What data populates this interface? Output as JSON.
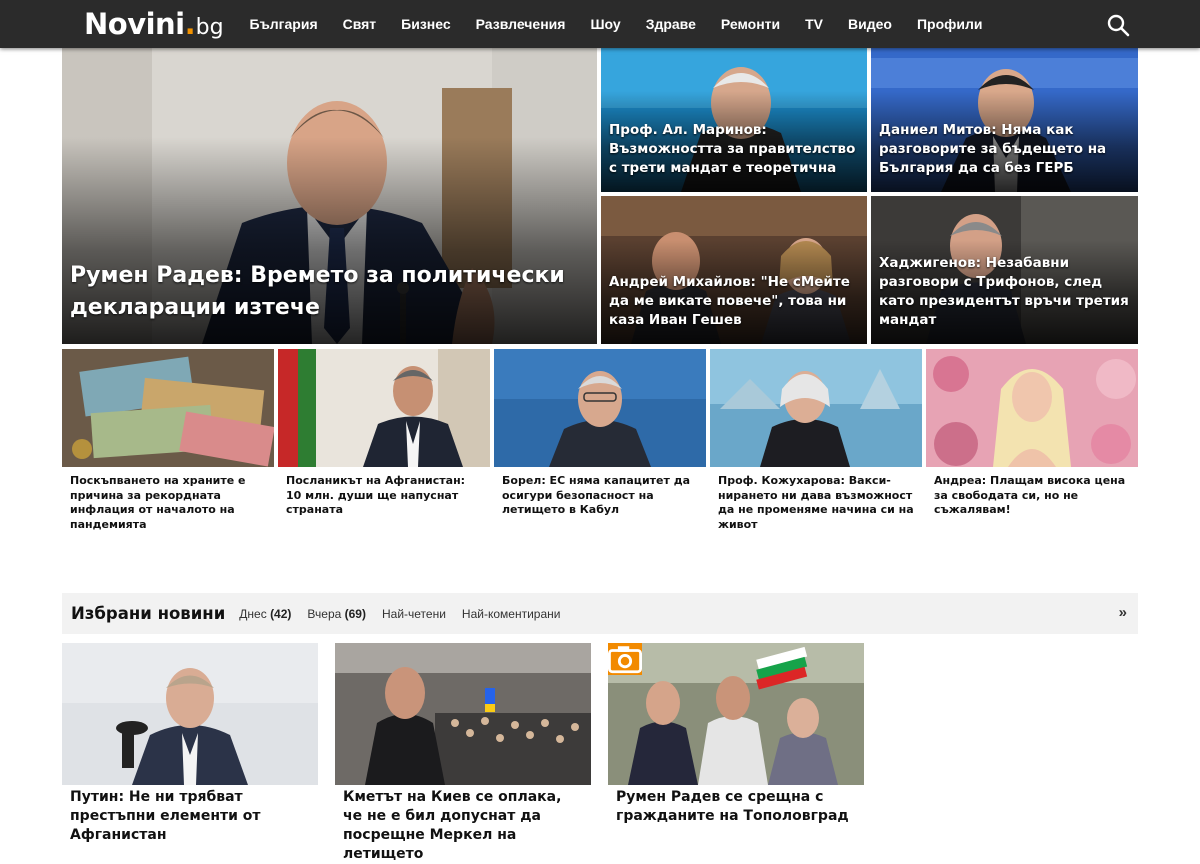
{
  "logo": {
    "main": "Novini",
    "dot": ".",
    "tld": "bg"
  },
  "nav": {
    "items": [
      "България",
      "Свят",
      "Бизнес",
      "Развлечения",
      "Шоу",
      "Здраве",
      "Ремонти",
      "TV",
      "Видео",
      "Профили"
    ],
    "search_icon": "search-icon"
  },
  "hero": {
    "main": {
      "title": "Румен Радев: Времето за политически декларации изтече"
    },
    "small": [
      {
        "title": "Проф. Ал. Маринов: Възможността за правителство с трети мандат е теоретична"
      },
      {
        "title": "Даниел Митов: Няма как разговорите за бъдещето на България да са без ГЕРБ"
      },
      {
        "title": "Андрей Михайлов: \"Не сМейте да ме викате повече\", това ни каза Иван Гешев"
      },
      {
        "title": "Хаджигенов: Незабавни разговори с Трифонов, след като президентът връчи третия мандат"
      }
    ]
  },
  "row": {
    "cards": [
      {
        "caption": "Поскъпването на храните е причина за рекордната инфлация от началото на пандемията"
      },
      {
        "caption": "Посланикът на Афганистан: 10 млн. души ще напуснат страната"
      },
      {
        "caption": "Борел: ЕС няма капацитет да осигури безопасност на летището в Кабул"
      },
      {
        "caption": "Проф. Кожухарова: Вакси­нирането ни дава възможност да не променяме начина си на живот"
      },
      {
        "caption": "Андреа: Плащам висока цена за свободата си, но не съжалявам!"
      }
    ]
  },
  "selected": {
    "title": "Избрани новини",
    "tabs": [
      {
        "label": "Днес",
        "count": "(42)"
      },
      {
        "label": "Вчера",
        "count": "(69)"
      },
      {
        "label": "Най-четени",
        "count": ""
      },
      {
        "label": "Най-коментирани",
        "count": ""
      }
    ],
    "more": "»",
    "cards": [
      {
        "caption": "Путин: Не ни трябват престъпни елементи от Афганистан"
      },
      {
        "caption": "Кметът на Киев се оплака, че не е бил допуснат да посрещне Меркел на летището"
      },
      {
        "caption": "Румен Радев се срещна с гражданите на Тополовград",
        "badge": "camera-icon"
      }
    ]
  },
  "colors": {
    "topbar": "#2b2b2b",
    "accent": "#f29200",
    "selected_bar": "#f2f2f2"
  }
}
